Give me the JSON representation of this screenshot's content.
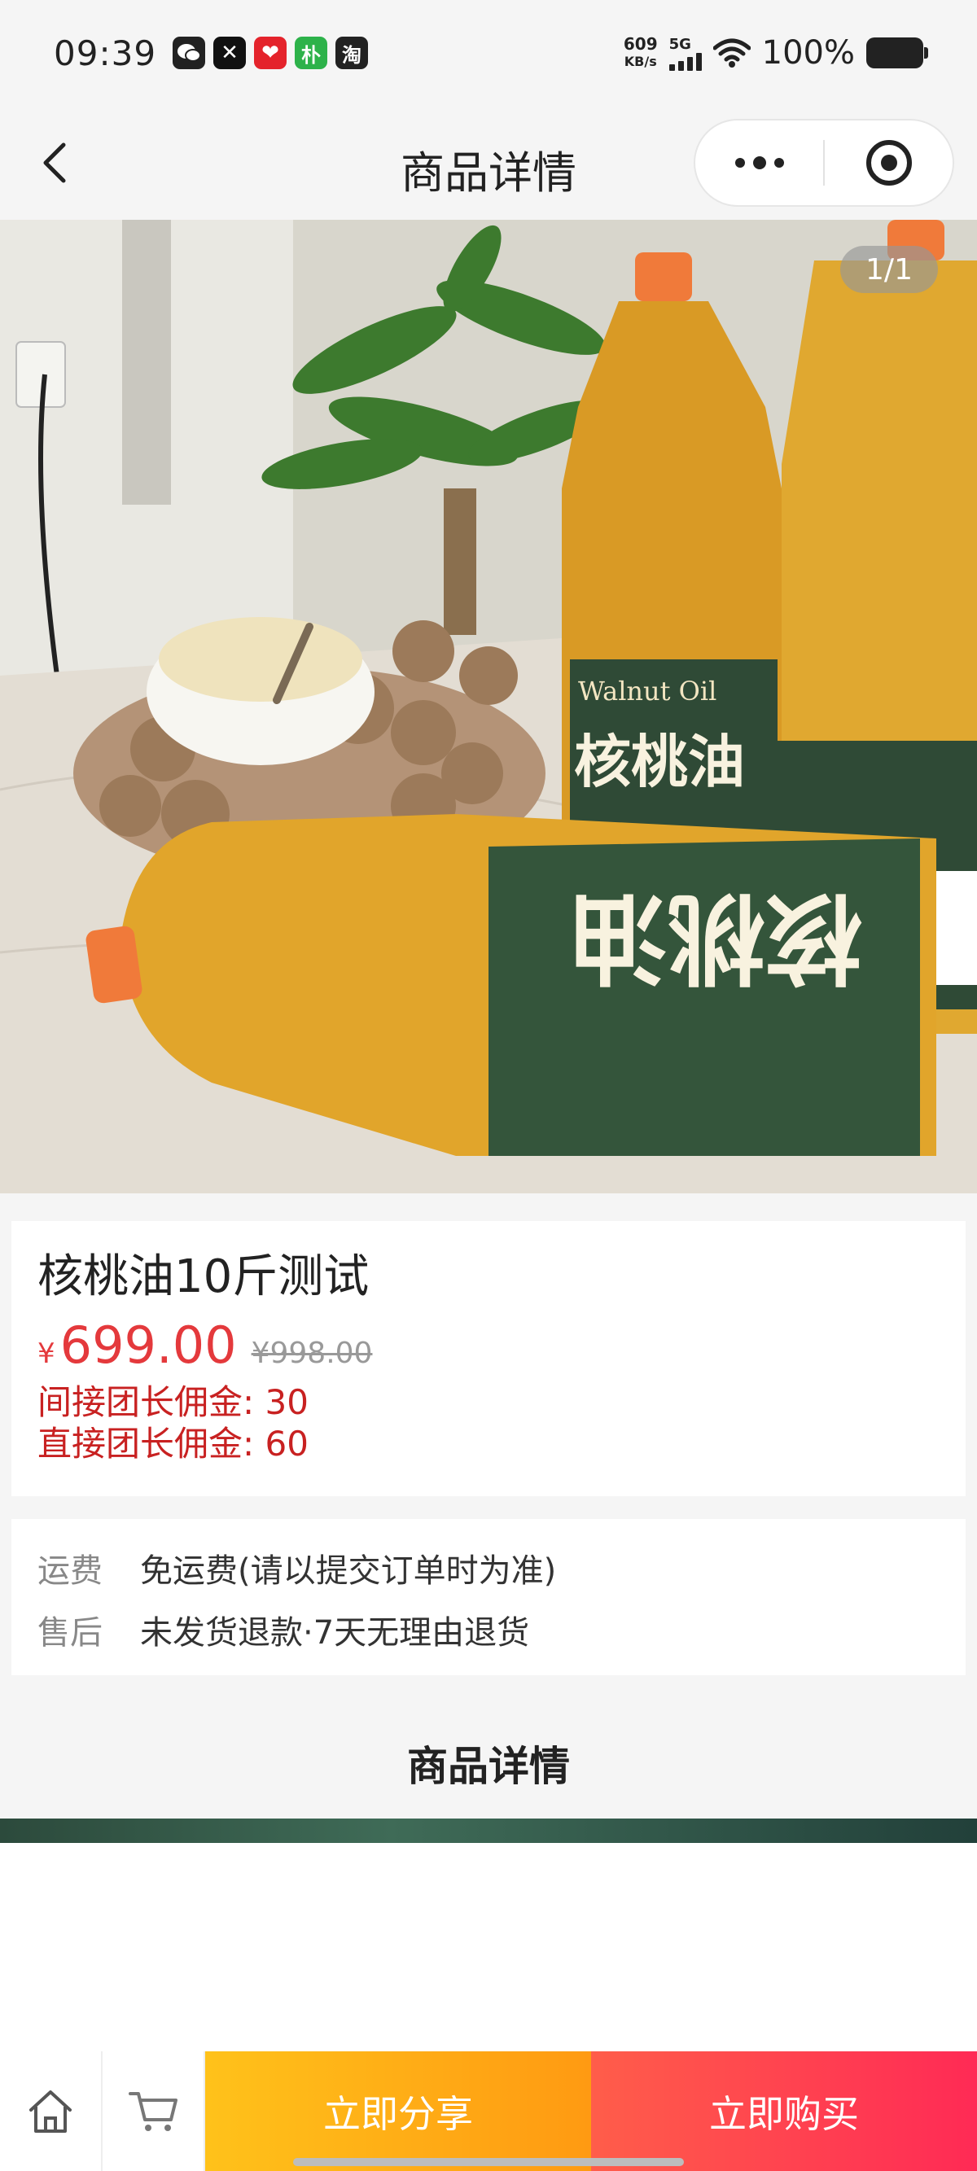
{
  "status_bar": {
    "time": "09:39",
    "apps": [
      {
        "name": "wechat-icon",
        "glyph": "●",
        "color": "#222222"
      },
      {
        "name": "capcut-icon",
        "glyph": "✕",
        "color": "#111111"
      },
      {
        "name": "red-app-icon",
        "glyph": "❤",
        "color": "#e4232b"
      },
      {
        "name": "pu-app-icon",
        "glyph": "朴",
        "color": "#2db24a"
      },
      {
        "name": "taobao-icon",
        "glyph": "淘",
        "color": "#222222"
      }
    ],
    "net_speed_value": "609",
    "net_speed_unit": "KB/s",
    "network": "5G",
    "battery": "100%"
  },
  "header": {
    "title": "商品详情"
  },
  "product": {
    "image_counter": "1/1",
    "name": "核桃油10斤测试",
    "currency": "¥",
    "price": "699.00",
    "original_price": "¥998.00",
    "commission_indirect": "间接团长佣金: 30",
    "commission_direct": "直接团长佣金: 60"
  },
  "services": [
    {
      "label": "运费",
      "value": "免运费(请以提交订单时为准)"
    },
    {
      "label": "售后",
      "value": "未发货退款·7天无理由退货"
    }
  ],
  "detail_section": {
    "title": "商品详情"
  },
  "bottom_bar": {
    "share_label": "立即分享",
    "buy_label": "立即购买"
  },
  "colors": {
    "price_red": "#e4393c",
    "commission_red": "#c82121",
    "share_orange": "#ffaa16",
    "buy_red": "#ff3a50"
  }
}
